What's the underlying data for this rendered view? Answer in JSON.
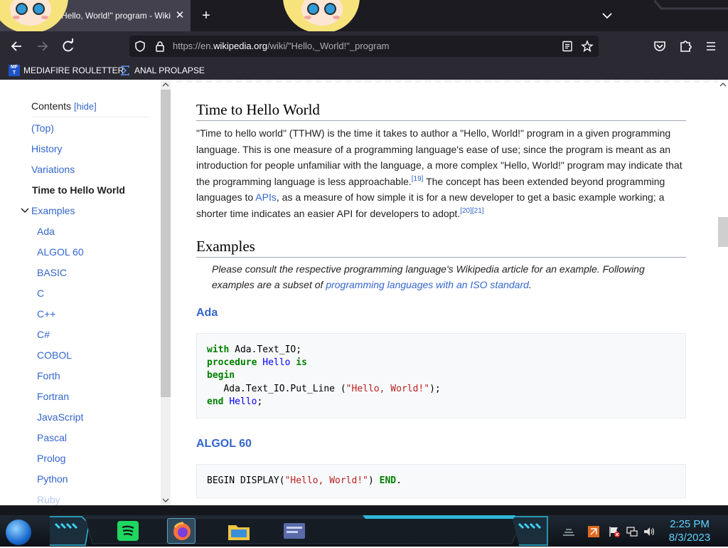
{
  "browser": {
    "tab_title": "Hello, World!\" program - Wiki",
    "tab_close": "✕",
    "new_tab": "+",
    "url_prefix": "https://en.",
    "url_domain": "wikipedia.org",
    "url_path": "/wiki/\"Hello,_World!\"_program",
    "bookmarks": [
      "MEDIAFIRE ROULETTER",
      "ANAL PROLAPSE"
    ],
    "bookmark_icon_text": "MF\nT"
  },
  "toc": {
    "heading": "Contents",
    "hide": "[hide]",
    "items": [
      {
        "label": "(Top)"
      },
      {
        "label": "History"
      },
      {
        "label": "Variations"
      },
      {
        "label": "Time to Hello World",
        "current": true
      },
      {
        "label": "Examples",
        "expanded": true
      },
      {
        "label": "Ada"
      },
      {
        "label": "ALGOL 60"
      },
      {
        "label": "BASIC"
      },
      {
        "label": "C"
      },
      {
        "label": "C++"
      },
      {
        "label": "C#"
      },
      {
        "label": "COBOL"
      },
      {
        "label": "Forth"
      },
      {
        "label": "Fortran"
      },
      {
        "label": "JavaScript"
      },
      {
        "label": "Pascal"
      },
      {
        "label": "Prolog"
      },
      {
        "label": "Python"
      },
      {
        "label": "Ruby"
      }
    ]
  },
  "article": {
    "section1_heading": "Time to Hello World",
    "para1_a": "\"Time to hello world\" (TTHW) is the time it takes to author a \"Hello, World!\" program in a given programming language. This is one measure of a programming language's ease of use; since the program is meant as an introduction for people unfamiliar with the language, a more complex \"Hello, World!\" program may indicate that the programming language is less approachable.",
    "ref19": "[19]",
    "para1_b": " The concept has been extended beyond programming languages to ",
    "apis_link": "APIs",
    "para1_c": ", as a measure of how simple it is for a new developer to get a basic example working; a shorter time indicates an easier API for developers to adopt.",
    "ref20": "[20]",
    "ref21": "[21]",
    "section2_heading": "Examples",
    "hatnote_a": "Please consult the respective programming language's Wikipedia article for an example. Following examples are a subset of ",
    "hatnote_link": "programming languages with an ISO standard",
    "hatnote_b": ".",
    "ada_heading": "Ada",
    "ada_code": {
      "l1_kw": "with",
      "l1_rest": " Ada.Text_IO;",
      "l2_kw": "procedure",
      "l2_name": "Hello",
      "l2_kw2": "is",
      "l3_kw": "begin",
      "l4_pre": "   Ada.Text_IO.Put_Line (",
      "l4_str": "\"Hello, World!\"",
      "l4_post": ");",
      "l5_kw": "end",
      "l5_name": "Hello",
      "l5_post": ";"
    },
    "algol_heading": "ALGOL 60",
    "algol_code": {
      "pre": "BEGIN DISPLAY(",
      "str": "\"Hello, World!\"",
      "mid": ") ",
      "kw": "END",
      "post": "."
    }
  },
  "taskbar": {
    "time": "2:25 PM",
    "date": "8/3/2023"
  },
  "colors": {
    "link": "#3366cc",
    "toolbar": "#2b2a33",
    "tabstrip": "#1c1b22"
  }
}
